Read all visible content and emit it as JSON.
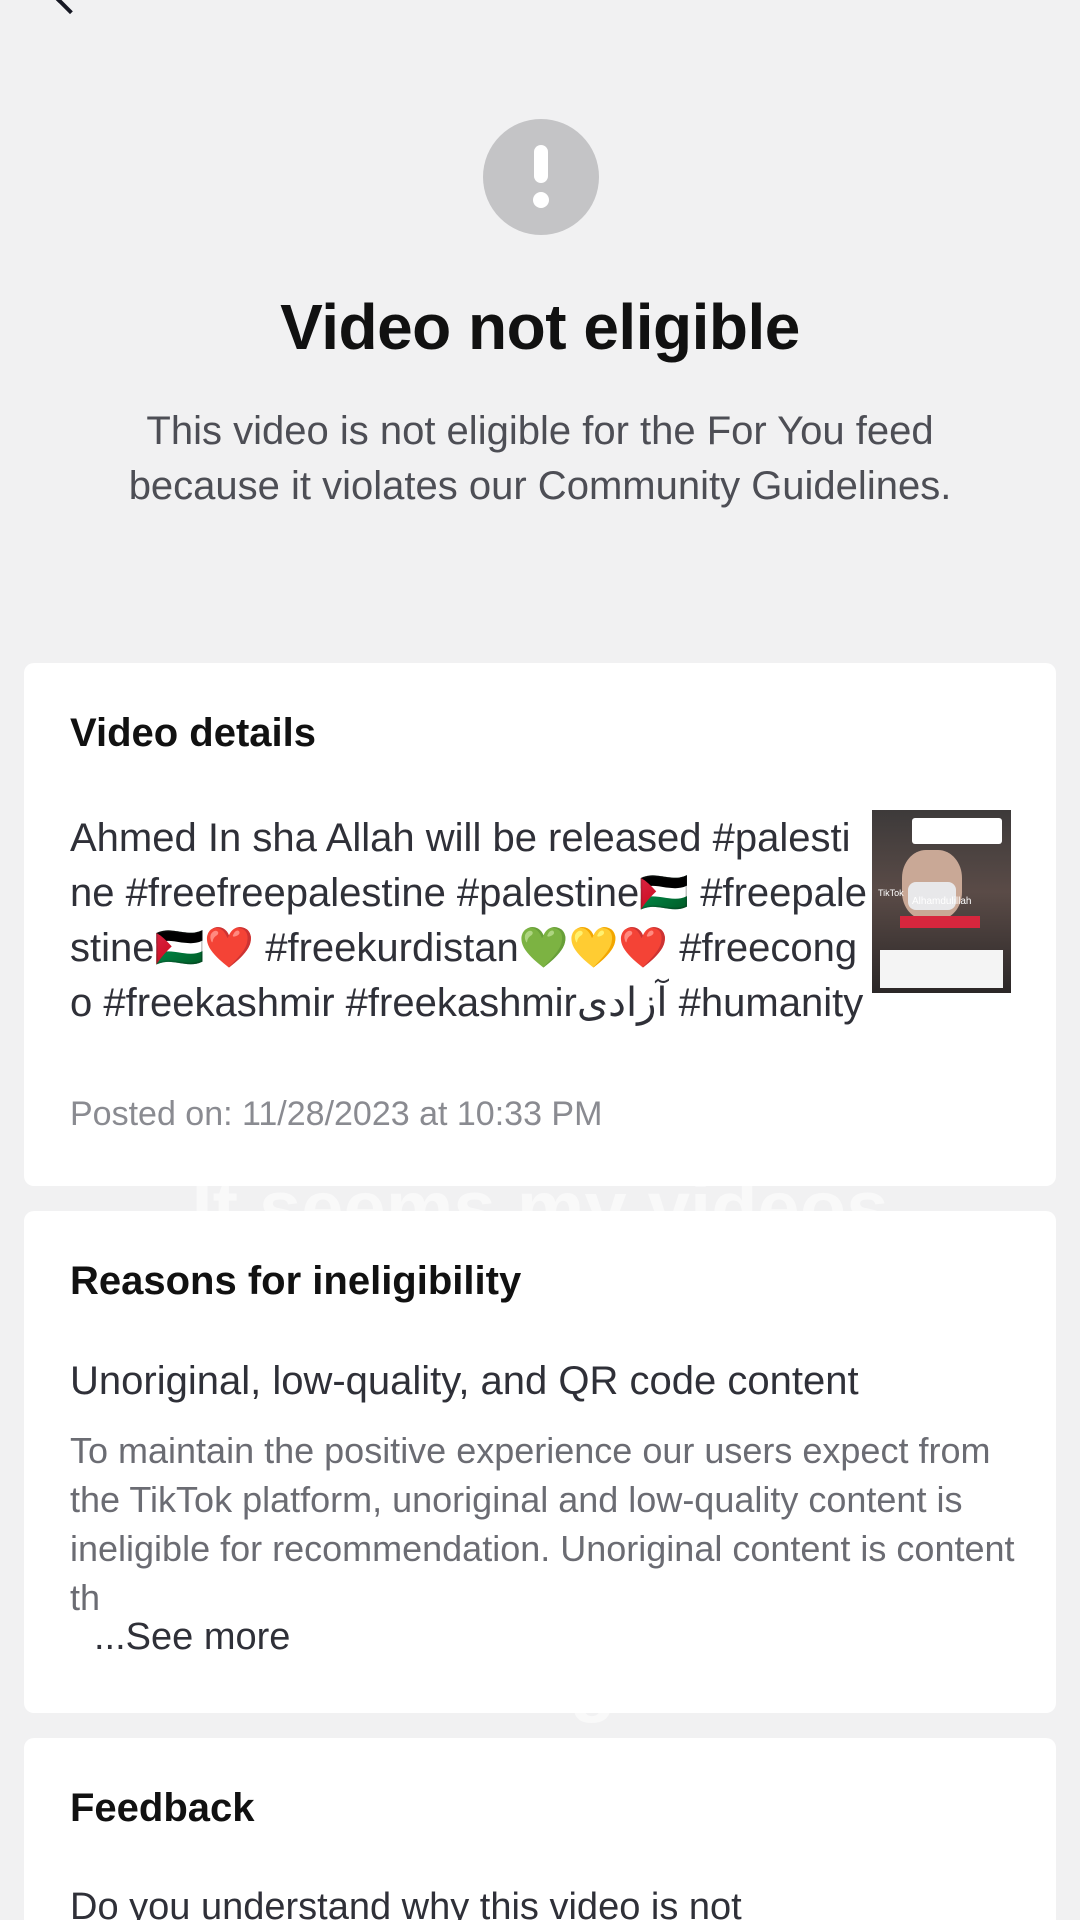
{
  "header": {
    "alert_icon": "exclamation-circle-icon",
    "title": "Video not eligible",
    "subtitle": "This video is not eligible for the For You feed because it violates our Community Guidelines."
  },
  "video_details": {
    "section_title": "Video details",
    "description": "Ahmed In sha Allah will be released #palestine #freefreepalestine #palestine🇵🇸 #freepalestine🇵🇸❤️ #freekurdistan💚💛❤️ #freecongo #freekashmir #freekashmirآزادی #humanity",
    "posted_on": "Posted on: 11/28/2023 at 10:33 PM",
    "thumbnail": {
      "watermark": "TikTok",
      "overlay_text": "Alhamdulillah"
    }
  },
  "reasons": {
    "section_title": "Reasons for ineligibility",
    "reason_title": "Unoriginal, low-quality, and QR code content",
    "reason_body": "To maintain the positive experience our users expect from the TikTok platform, unoriginal and low-quality content is ineligible for recommendation. Unoriginal content is content th",
    "see_more": "...See more"
  },
  "feedback": {
    "section_title": "Feedback",
    "question": "Do you understand why this video is not"
  },
  "overlay_captions": {
    "line1": "It seems my videos",
    "line2": "are doing well!"
  },
  "colors": {
    "background": "#f1f1f2",
    "card": "#ffffff",
    "icon_gray": "#c4c4c6",
    "text_primary": "#111111",
    "text_secondary": "#6b6c73"
  }
}
